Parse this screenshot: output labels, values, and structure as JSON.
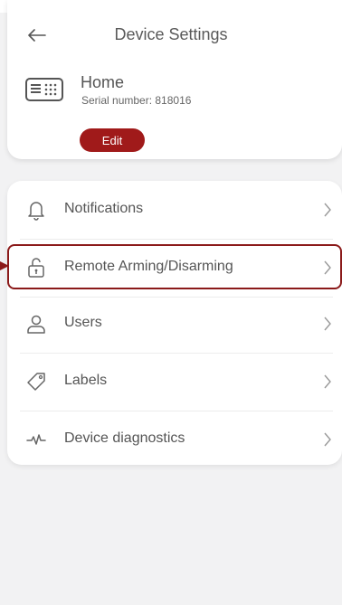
{
  "header": {
    "title": "Device Settings",
    "back_icon": "arrow-left-icon"
  },
  "device": {
    "name": "Home",
    "serial": "Serial number: 818016",
    "icon": "keypad-icon",
    "edit_label": "Edit"
  },
  "menu": {
    "items": [
      {
        "label": "Notifications",
        "icon": "bell-icon"
      },
      {
        "label": "Remote Arming/Disarming",
        "icon": "unlock-icon",
        "highlighted": true
      },
      {
        "label": "Users",
        "icon": "user-icon"
      },
      {
        "label": "Labels",
        "icon": "tag-icon"
      },
      {
        "label": "Device diagnostics",
        "icon": "pulse-icon"
      }
    ]
  },
  "colors": {
    "accent": "#a01a1a",
    "highlight_border": "#8b1a1a",
    "background": "#f2f2f3",
    "text": "#555555"
  }
}
